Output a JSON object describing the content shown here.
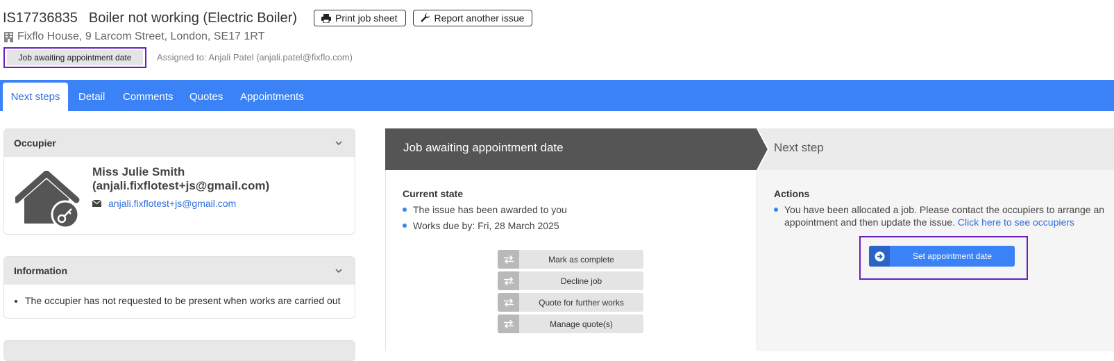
{
  "header": {
    "job_id": "IS17736835",
    "job_title": "Boiler not working (Electric Boiler)",
    "print_label": "Print job sheet",
    "report_label": "Report another issue",
    "address": "Fixflo House, 9 Larcom Street, London, SE17 1RT",
    "status": "Job awaiting appointment date",
    "assigned": "Assigned to: Anjali Patel (anjali.patel@fixflo.com)"
  },
  "tabs": [
    "Next steps",
    "Detail",
    "Comments",
    "Quotes",
    "Appointments"
  ],
  "occupier": {
    "title": "Occupier",
    "name_line1": "Miss Julie Smith",
    "name_line2": "(anjali.fixflotest+js@gmail.com)",
    "email": "anjali.fixflotest+js@gmail.com"
  },
  "information": {
    "title": "Information",
    "items": [
      "The occupier has not requested to be present when works are carried out"
    ]
  },
  "workflow": {
    "current_header": "Job awaiting appointment date",
    "next_header": "Next step",
    "current_state_title": "Current state",
    "current_state_items": [
      "The issue has been awarded to you",
      "Works due by: Fri, 28 March 2025"
    ],
    "action_buttons": [
      "Mark as complete",
      "Decline job",
      "Quote for further works",
      "Manage quote(s)"
    ],
    "actions_title": "Actions",
    "actions_text": "You have been allocated a job. Please contact the occupiers to arrange an appointment and then update the issue.",
    "actions_link": "Click here to see occupiers",
    "set_appointment_label": "Set appointment date"
  },
  "colors": {
    "tab_bar": "#3b82f6",
    "highlight": "#6a1fbd",
    "link": "#2f6fdc",
    "dark_header": "#555555"
  }
}
